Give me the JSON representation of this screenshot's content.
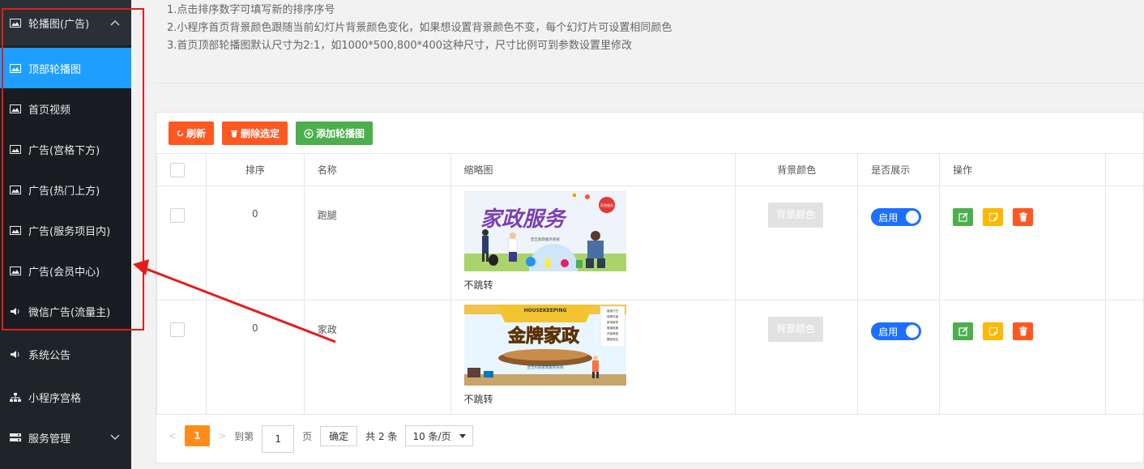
{
  "notice": {
    "lines": [
      "1.点击排序数字可填写新的排序序号",
      "2.小程序首页背景颜色跟随当前幻灯片背景颜色变化，如果想设置背景颜色不变，每个幻灯片可设置相同颜色",
      "3.首页顶部轮播图默认尺寸为2:1，如1000*500,800*400这种尺寸，尺寸比例可到参数设置里修改"
    ]
  },
  "sidebar": {
    "parent": {
      "label": "轮播图(广告)"
    },
    "items": [
      {
        "label": "顶部轮播图",
        "active": true
      },
      {
        "label": "首页视频"
      },
      {
        "label": "广告(宫格下方)"
      },
      {
        "label": "广告(热门上方)"
      },
      {
        "label": "广告(服务项目内)"
      },
      {
        "label": "广告(会员中心)"
      },
      {
        "label": "微信广告(流量主)"
      }
    ],
    "bottom": [
      {
        "label": "系统公告"
      },
      {
        "label": "小程序宫格"
      },
      {
        "label": "服务管理"
      }
    ]
  },
  "toolbar": {
    "refresh_label": "刷新",
    "delete_label": "删除选定",
    "add_label": "添加轮播图"
  },
  "table": {
    "headers": [
      "排序",
      "名称",
      "缩略图",
      "背景颜色",
      "是否展示",
      "操作"
    ],
    "rows": [
      {
        "sort": "0",
        "name": "跑腿",
        "jump": "不跳转",
        "bg": "背景颜色",
        "show": "启用"
      },
      {
        "sort": "0",
        "name": "家政",
        "jump": "不跳转",
        "bg": "背景颜色",
        "show": "启用"
      }
    ]
  },
  "images": {
    "banner1_title": "家政服务",
    "banner1_bubble": "家政服务",
    "banner1_sub": "普吉家政服务系统",
    "banner2_top": "HOUSEKEEPING",
    "banner2_title": "金牌家政",
    "banner2_sub": "普吉科技家政服务系统",
    "banner2_list": [
      "做饭打扫",
      "保姆月嫂",
      "家电维修",
      "管道疏通",
      "开锁换锁",
      "搬家保洁"
    ]
  },
  "pager": {
    "prev": "<",
    "current": "1",
    "next": ">",
    "goto_label": "到第",
    "page_input": "1",
    "page_unit": "页",
    "confirm_label": "确定",
    "total": "共 2 条",
    "page_size": "10 条/页"
  },
  "colors": {
    "sidebar_bg": "#1f2428",
    "active_item": "#1e9fff",
    "btn_orange": "#ff5722",
    "btn_green": "#4cae4c",
    "switch_on": "#1e6fff",
    "pager_current": "#ff8c1a",
    "annotation": "#e61b1b"
  }
}
